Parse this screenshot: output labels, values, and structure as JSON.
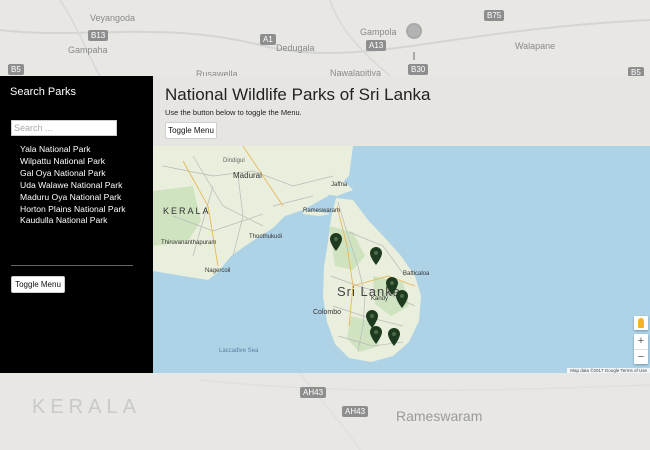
{
  "background_map": {
    "labels": [
      "Veyangoda",
      "Gampaha",
      "Dedugala",
      "Gampola",
      "Walapane",
      "Nawalapitiya",
      "Rusawella"
    ],
    "route_shields": [
      "B13",
      "A1",
      "A13",
      "B5",
      "B30",
      "B75",
      "B5"
    ],
    "kerala": "KERALA",
    "rameswaram": "Rameswaram",
    "highway_shields": [
      "AH43",
      "AH43"
    ]
  },
  "sidebar": {
    "title": "Search Parks",
    "search_placeholder": "Search ...",
    "parks": [
      "Yala National Park",
      "Wilpattu National Park",
      "Gal Oya National Park",
      "Uda Walawe National Park",
      "Maduru Oya National Park",
      "Horton Plains National Park",
      "Kaudulla National Park"
    ],
    "toggle_label": "Toggle Menu"
  },
  "header": {
    "title": "National Wildlife Parks of Sri Lanka",
    "subtitle": "Use the button below to toggle the Menu.",
    "toggle_label": "Toggle Menu"
  },
  "map": {
    "labels": {
      "kerala": "KERALA",
      "sri_lanka": "Sri Lanka",
      "madurai": "Madurai",
      "rameswaram": "Rameswaram",
      "thoothukudi": "Thoothukudi",
      "thiruvananthapuram": "Thiruvananthapuram",
      "colombo": "Colombo",
      "jaffna": "Jaffna",
      "laccadive_sea": "Laccadive Sea",
      "batticaloa": "Batticaloa",
      "kandy": "Kandy",
      "dindigul": "Dindigul",
      "nagercoil": "Nagercoil"
    },
    "zoom_in": "+",
    "zoom_out": "−",
    "attribution": "Map data ©2017 Google   Terms of Use",
    "marker_color": "#1f3b1f",
    "land_color": "#e9efdc",
    "water_color": "#aed3e7"
  }
}
